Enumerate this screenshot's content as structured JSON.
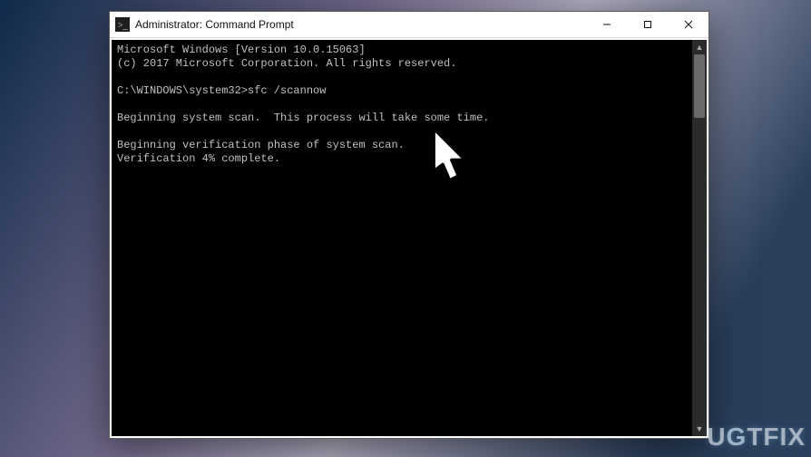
{
  "window": {
    "title": "Administrator: Command Prompt"
  },
  "console": {
    "lines": {
      "l0": "Microsoft Windows [Version 10.0.15063]",
      "l1": "(c) 2017 Microsoft Corporation. All rights reserved.",
      "l2": "",
      "l3": "C:\\WINDOWS\\system32>sfc /scannow",
      "l4": "",
      "l5": "Beginning system scan.  This process will take some time.",
      "l6": "",
      "l7": "Beginning verification phase of system scan.",
      "l8": "Verification 4% complete."
    }
  },
  "watermark": {
    "text_pre": "U",
    "text_accent": "G",
    "text_mid": "TFIX"
  }
}
